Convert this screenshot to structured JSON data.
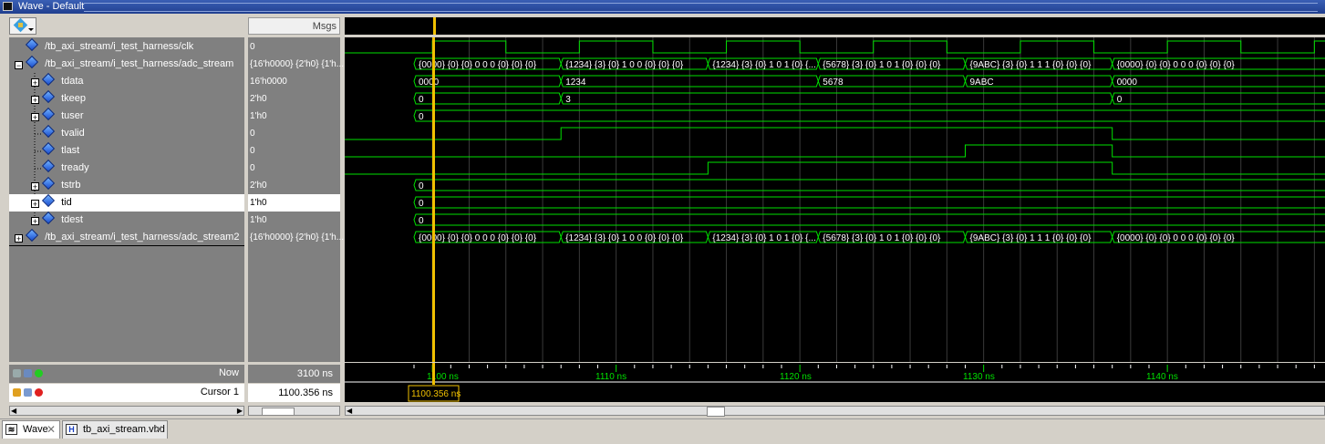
{
  "window": {
    "title": "Wave - Default"
  },
  "header": {
    "msgs_label": "Msgs"
  },
  "signals": [
    {
      "name": "/tb_axi_stream/i_test_harness/clk",
      "value": "0",
      "expander": "",
      "indent": 0
    },
    {
      "name": "/tb_axi_stream/i_test_harness/adc_stream",
      "value": "{16'h0000} {2'h0} {1'h...",
      "expander": "-",
      "indent": 0
    },
    {
      "name": "tdata",
      "value": "16'h0000",
      "expander": "+",
      "indent": 1
    },
    {
      "name": "tkeep",
      "value": "2'h0",
      "expander": "+",
      "indent": 1
    },
    {
      "name": "tuser",
      "value": "1'h0",
      "expander": "+",
      "indent": 1
    },
    {
      "name": "tvalid",
      "value": "0",
      "expander": "",
      "indent": 1
    },
    {
      "name": "tlast",
      "value": "0",
      "expander": "",
      "indent": 1
    },
    {
      "name": "tready",
      "value": "0",
      "expander": "",
      "indent": 1
    },
    {
      "name": "tstrb",
      "value": "2'h0",
      "expander": "+",
      "indent": 1
    },
    {
      "name": "tid",
      "value": "1'h0",
      "expander": "+",
      "indent": 1
    },
    {
      "name": "tdest",
      "value": "1'h0",
      "expander": "+",
      "indent": 1
    },
    {
      "name": "/tb_axi_stream/i_test_harness/adc_stream2",
      "value": "{16'h0000} {2'h0} {1'h...",
      "expander": "+",
      "indent": 0
    }
  ],
  "selected_signal": "tid",
  "waves": {
    "bus_labels": [
      "{0000} {0} {0} 0 0 0 {0} {0} {0}",
      "{1234} {3} {0} 1 0 0 {0} {0} {0}",
      "{1234} {3} {0} 1 0 1 {0} {...",
      "{5678} {3} {0} 1 0 1 {0} {0} {0}",
      "{9ABC} {3} {0} 1 1 1 {0} {0} {0}",
      "{0000} {0} {0} 0 0 0 {0} {0} {0}"
    ],
    "tdata_labels": [
      "0000",
      "1234",
      "5678",
      "9ABC",
      "0000"
    ],
    "tkeep_labels": [
      "0",
      "3",
      "0"
    ],
    "zero_label": "0"
  },
  "status": {
    "now_label": "Now",
    "now_value": "3100 ns",
    "cursor_label": "Cursor 1",
    "cursor_value": "1100.356 ns",
    "cursor_flag": "1100.356 ns"
  },
  "timeline": {
    "ticks": [
      "1100 ns",
      "1110 ns",
      "1120 ns",
      "1130 ns",
      "1140 ns"
    ]
  },
  "tabs": [
    {
      "label": "Wave",
      "icon": "wave-icon",
      "active": true
    },
    {
      "label": "tb_axi_stream.vhd",
      "icon": "vhdl-file-icon",
      "active": false
    }
  ],
  "colors": {
    "wave": "#00e000",
    "cursor": "#f0c000",
    "bg": "#000000",
    "pane": "#808080"
  }
}
